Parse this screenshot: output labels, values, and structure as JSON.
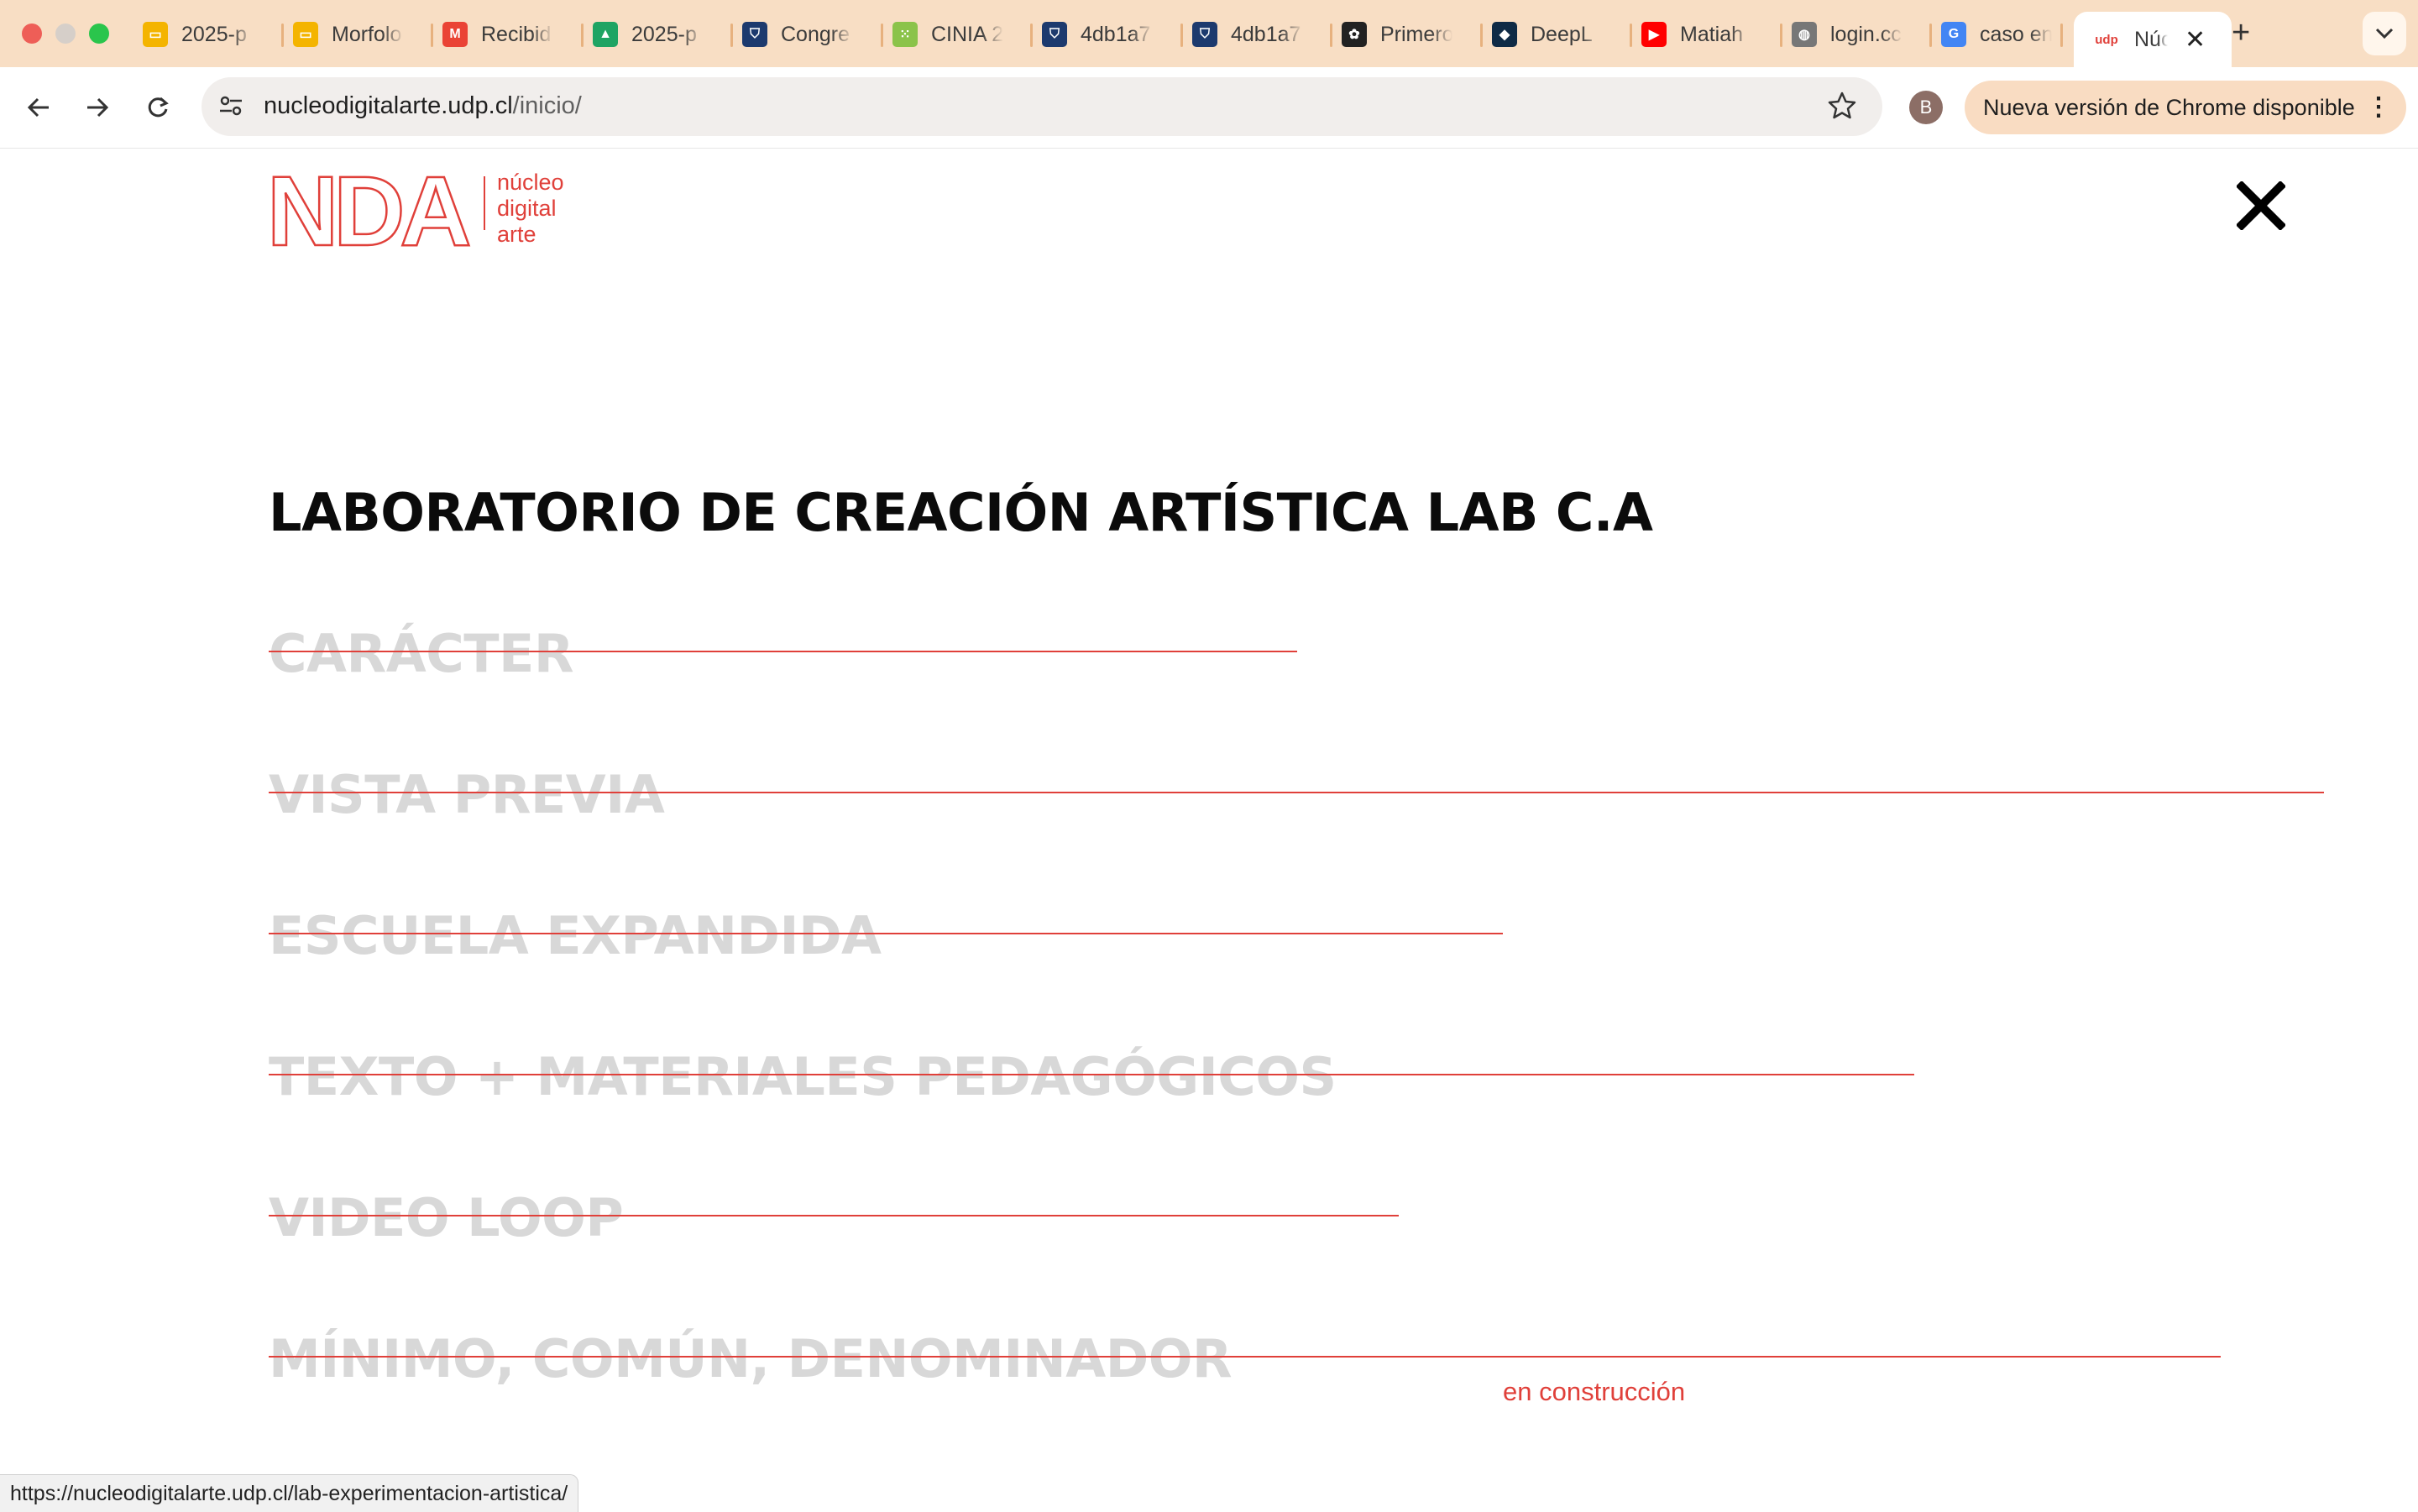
{
  "browser": {
    "tabs": [
      {
        "title": "2025-p",
        "icon": "slides-icon",
        "color": "#f4b400"
      },
      {
        "title": "Morfolo",
        "icon": "slides-icon",
        "color": "#f4b400"
      },
      {
        "title": "Recibid",
        "icon": "gmail-icon",
        "color": "#ea4335"
      },
      {
        "title": "2025-p",
        "icon": "drive-icon",
        "color": "#1fa463"
      },
      {
        "title": "Congre",
        "icon": "shield-crest-icon",
        "color": "#1d3a6e"
      },
      {
        "title": "CINIA 2",
        "icon": "dots-grid-icon",
        "color": "#8bc34a"
      },
      {
        "title": "4db1a7",
        "icon": "shield-crest-icon",
        "color": "#1d3a6e"
      },
      {
        "title": "4db1a7",
        "icon": "shield-crest-icon",
        "color": "#1d3a6e"
      },
      {
        "title": "Primero",
        "icon": "openai-icon",
        "color": "#222222"
      },
      {
        "title": "DeepL",
        "icon": "deepl-icon",
        "color": "#0f2b46"
      },
      {
        "title": "Matiah",
        "icon": "youtube-icon",
        "color": "#ff0000"
      },
      {
        "title": "login.cc",
        "icon": "globe-icon",
        "color": "#777777"
      },
      {
        "title": "caso en",
        "icon": "google-icon",
        "color": "#4285f4"
      }
    ],
    "active_tab": {
      "title": "Núcleo",
      "icon_text": "udp"
    },
    "url_domain": "nucleodigitalarte.udp.cl",
    "url_path": "/inicio/",
    "profile_initial": "B",
    "update_label": "Nueva versión de Chrome disponible",
    "status_url": "https://nucleodigitalarte.udp.cl/lab-experimentacion-artistica/"
  },
  "site": {
    "logo_letters": "NDA",
    "logo_words": [
      "núcleo",
      "digital",
      "arte"
    ],
    "accent_color": "#e0403a",
    "page_title": "LABORATORIO DE CREACIÓN ARTÍSTICA LAB C.A",
    "menu": [
      {
        "label": "CARÁCTER"
      },
      {
        "label": "VISTA PREVIA"
      },
      {
        "label": "ESCUELA EXPANDIDA"
      },
      {
        "label": "TEXTO + MATERIALES PEDAGÓGICOS"
      },
      {
        "label": "VIDEO LOOP"
      },
      {
        "label": "MÍNIMO, COMÚN, DENOMINADOR"
      }
    ],
    "construction_note": "en construcción"
  }
}
